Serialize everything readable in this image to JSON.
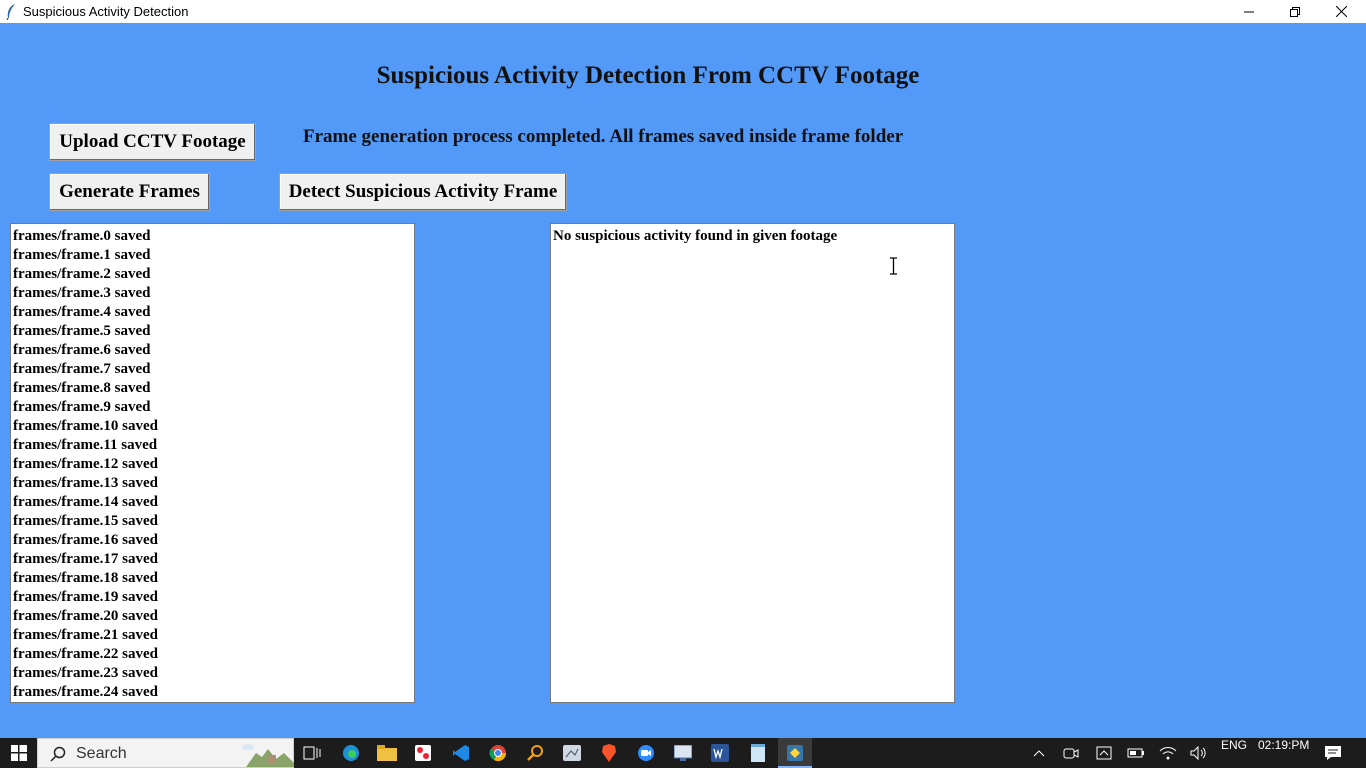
{
  "window": {
    "title": "Suspicious Activity Detection"
  },
  "heading": "Suspicious Activity Detection From CCTV Footage",
  "status_message": "Frame generation process completed. All frames saved inside frame folder",
  "buttons": {
    "upload": "Upload CCTV Footage",
    "generate": "Generate Frames",
    "detect": "Detect Suspicious Activity Frame"
  },
  "frames_log": [
    "frames/frame.0 saved",
    "frames/frame.1 saved",
    "frames/frame.2 saved",
    "frames/frame.3 saved",
    "frames/frame.4 saved",
    "frames/frame.5 saved",
    "frames/frame.6 saved",
    "frames/frame.7 saved",
    "frames/frame.8 saved",
    "frames/frame.9 saved",
    "frames/frame.10 saved",
    "frames/frame.11 saved",
    "frames/frame.12 saved",
    "frames/frame.13 saved",
    "frames/frame.14 saved",
    "frames/frame.15 saved",
    "frames/frame.16 saved",
    "frames/frame.17 saved",
    "frames/frame.18 saved",
    "frames/frame.19 saved",
    "frames/frame.20 saved",
    "frames/frame.21 saved",
    "frames/frame.22 saved",
    "frames/frame.23 saved",
    "frames/frame.24 saved"
  ],
  "result_text": "No suspicious activity found in given footage",
  "colors": {
    "background": "#5299F8",
    "taskbar": "#1c1c1c"
  },
  "taskbar": {
    "search_placeholder": "Search",
    "apps": [
      "task-view-icon",
      "edge-icon",
      "file-explorer-icon",
      "app-icon",
      "vscode-icon",
      "chrome-icon",
      "search-app-icon",
      "app-icon",
      "brave-icon",
      "zoom-icon",
      "app-icon",
      "word-icon",
      "notepad-icon",
      "python-icon"
    ],
    "tray": {
      "language": "ENG",
      "time": "02:19:PM"
    }
  }
}
